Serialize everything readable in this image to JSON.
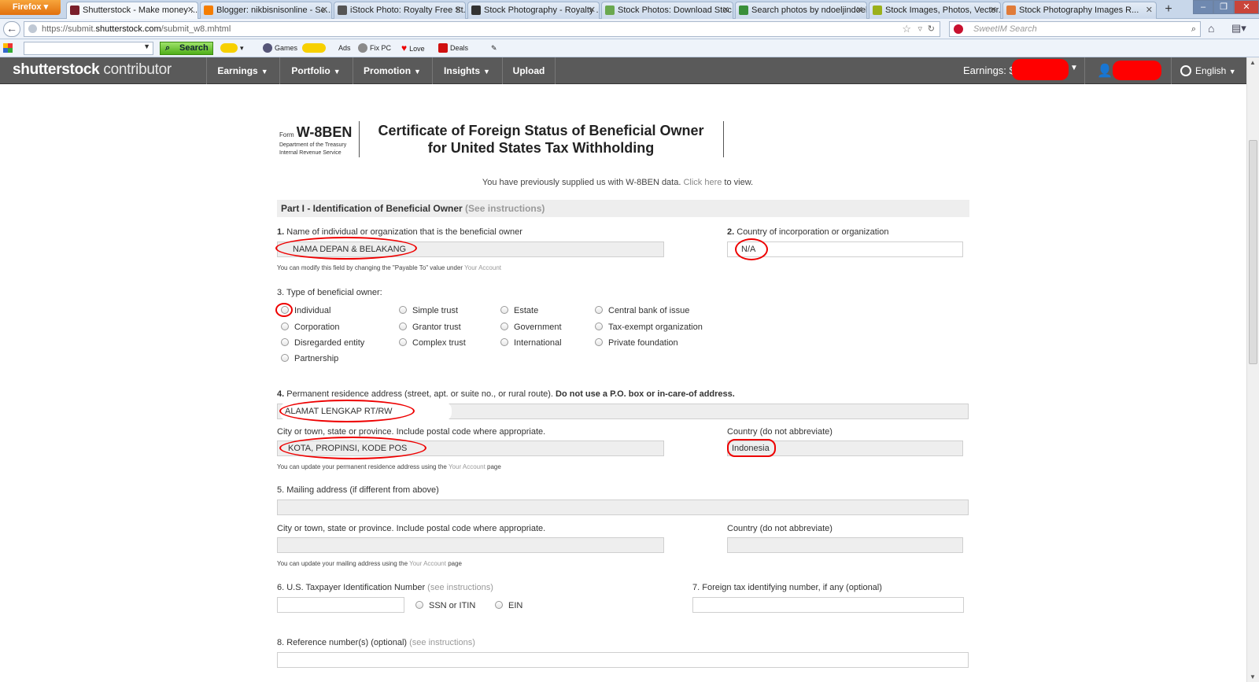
{
  "browser": {
    "app_button": "Firefox",
    "tabs": [
      {
        "title": "Shutterstock - Make money ...",
        "active": true,
        "color": "#7a1f2b"
      },
      {
        "title": "Blogger: nikbisnisonline - Se...",
        "active": false,
        "color": "#f57d00"
      },
      {
        "title": "iStock Photo: Royalty Free St...",
        "active": false,
        "color": "#555555"
      },
      {
        "title": "Stock Photography - Royalty ...",
        "active": false,
        "color": "#333333"
      },
      {
        "title": "Stock Photos: Download Stoc...",
        "active": false,
        "color": "#6aa84f"
      },
      {
        "title": "Search photos by ndoeljindoel",
        "active": false,
        "color": "#3a8f3a"
      },
      {
        "title": "Stock Images, Photos, Vector...",
        "active": false,
        "color": "#9bb01a"
      },
      {
        "title": "Stock Photography Images R...",
        "active": false,
        "color": "#e07b39"
      }
    ],
    "url_prefix": "https://submit.",
    "url_domain": "shutterstock.com",
    "url_path": "/submit_w8.mhtml",
    "search_placeholder": "SweetIM Search"
  },
  "toolbar": {
    "search_label": "Search",
    "items": [
      "Games",
      "Ads",
      "Fix PC",
      "Love",
      "Deals"
    ]
  },
  "site": {
    "logo_main": "shutterst",
    "logo_o": "o",
    "logo_rest": "ck",
    "logo_suffix": " contributor",
    "nav": [
      {
        "label": "Earnings"
      },
      {
        "label": "Portfolio"
      },
      {
        "label": "Promotion"
      },
      {
        "label": "Insights"
      },
      {
        "label": "Upload"
      }
    ],
    "earnings_label": "Earnings: $",
    "language": "English"
  },
  "form": {
    "form_word": "Form",
    "form_code": "W-8BEN",
    "dept_line1": "Department of the Treasury",
    "dept_line2": "Internal Revenue Service",
    "title_line1": "Certificate of Foreign Status of Beneficial Owner",
    "title_line2": "for United States Tax Withholding",
    "prev_note_pre": "You have previously supplied us with W-8BEN data. ",
    "prev_note_link": "Click here",
    "prev_note_post": " to view.",
    "part1_title": "Part I - Identification of Beneficial Owner ",
    "part1_link": "(See instructions)",
    "q1_num": "1.",
    "q1_label": " Name of individual or organization that is the beneficial owner",
    "q1_value": "NAMA  DEPAN & BELAKANG",
    "q1_hint_pre": "You can modify this field by changing the \"Payable To\" value under ",
    "q1_hint_link": "Your Account",
    "q2_num": "2.",
    "q2_label": " Country of incorporation or organization",
    "q2_value": "N/A",
    "q3_label": "3. Type of beneficial owner:",
    "owner_types": [
      [
        "Individual",
        "Corporation",
        "Disregarded entity",
        "Partnership"
      ],
      [
        "Simple trust",
        "Grantor trust",
        "Complex trust"
      ],
      [
        "Estate",
        "Government",
        "International"
      ],
      [
        "Central bank of issue",
        "Tax-exempt organization",
        "Private foundation"
      ]
    ],
    "q4_num": "4.",
    "q4_label": " Permanent residence address (street, apt. or suite no., or rural route). ",
    "q4_bold": "Do not use a P.O. box or in-care-of address.",
    "q4_value": "ALAMAT LENGKAP RT/RW",
    "city_label": "City or town, state or province. Include postal code where appropriate.",
    "city_value": "KOTA, PROPINSI, KODE POS",
    "country_label": "Country (do not abbreviate)",
    "country_value": "Indonesia",
    "addr_hint_pre": "You can update your permanent residence address using the ",
    "addr_hint_link": "Your Account",
    "addr_hint_post": " page",
    "q5_label": "5. Mailing address (if different from above)",
    "mail_city_label": "City or town, state or province. Include postal code where appropriate.",
    "mail_country_label": "Country (do not abbreviate)",
    "mail_hint_pre": "You can update your mailing address using the ",
    "mail_hint_link": "Your Account",
    "mail_hint_post": " page",
    "q6_label": "6. U.S. Taxpayer Identification Number ",
    "q6_link": "(see instructions)",
    "ssn_label": "SSN or ITIN",
    "ein_label": "EIN",
    "q7_label": "7. Foreign tax identifying number, if any (optional)",
    "q8_label": "8. Reference number(s) (optional) ",
    "q8_link": "(see instructions)"
  },
  "colors": {
    "header_bg": "#5a5a5a",
    "annotation_red": "#e00000",
    "link_gray": "#999999"
  }
}
